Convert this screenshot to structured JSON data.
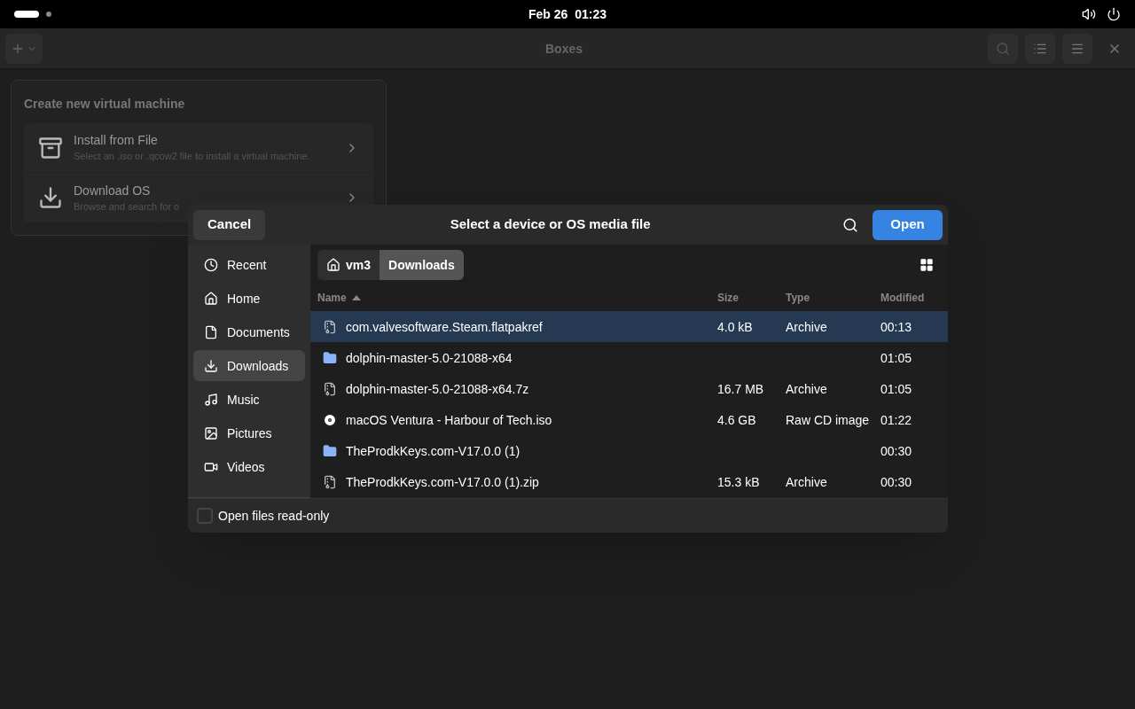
{
  "top_bar": {
    "clock": "Feb 26  01:23"
  },
  "header": {
    "title": "Boxes"
  },
  "popover": {
    "title": "Create new virtual machine",
    "items": [
      {
        "kind": "file",
        "title": "Install from File",
        "subtitle": "Select an .iso or .qcow2 file to install a virtual machine."
      },
      {
        "kind": "download",
        "title": "Download OS",
        "subtitle": "Browse and search for o"
      }
    ]
  },
  "dialog": {
    "title": "Select a device or OS media file",
    "cancel": "Cancel",
    "open": "Open",
    "sidebar": [
      {
        "kind": "recent",
        "label": "Recent",
        "selected": false
      },
      {
        "kind": "home",
        "label": "Home",
        "selected": false
      },
      {
        "kind": "documents",
        "label": "Documents",
        "selected": false
      },
      {
        "kind": "downloads",
        "label": "Downloads",
        "selected": true
      },
      {
        "kind": "music",
        "label": "Music",
        "selected": false
      },
      {
        "kind": "pictures",
        "label": "Pictures",
        "selected": false
      },
      {
        "kind": "videos",
        "label": "Videos",
        "selected": false
      }
    ],
    "path": [
      {
        "label": "vm3",
        "selected": false
      },
      {
        "label": "Downloads",
        "selected": true
      }
    ],
    "columns": [
      {
        "label": "Name",
        "sorted": true
      },
      {
        "label": "Size",
        "sorted": false
      },
      {
        "label": "Type",
        "sorted": false
      },
      {
        "label": "Modified",
        "sorted": false
      }
    ],
    "rows": [
      {
        "kind": "archive",
        "name": "com.valvesoftware.Steam.flatpakref",
        "size": "4.0 kB",
        "type": "Archive",
        "modified": "00:13",
        "selected": true
      },
      {
        "kind": "folder",
        "name": "dolphin-master-5.0-21088-x64",
        "modified": "01:05",
        "selected": false
      },
      {
        "kind": "archive",
        "name": "dolphin-master-5.0-21088-x64.7z",
        "size": "16.7 MB",
        "type": "Archive",
        "modified": "01:05",
        "selected": false
      },
      {
        "kind": "disc",
        "name": "macOS Ventura - Harbour of Tech.iso",
        "size": "4.6 GB",
        "type": "Raw CD image",
        "modified": "01:22",
        "selected": false
      },
      {
        "kind": "folder",
        "name": "TheProdkKeys.com-V17.0.0 (1)",
        "modified": "00:30",
        "selected": false
      },
      {
        "kind": "archive",
        "name": "TheProdkKeys.com-V17.0.0 (1).zip",
        "size": "15.3 kB",
        "type": "Archive",
        "modified": "00:30",
        "selected": false
      }
    ],
    "read_only": {
      "label": "Open files read-only",
      "checked": false
    }
  }
}
